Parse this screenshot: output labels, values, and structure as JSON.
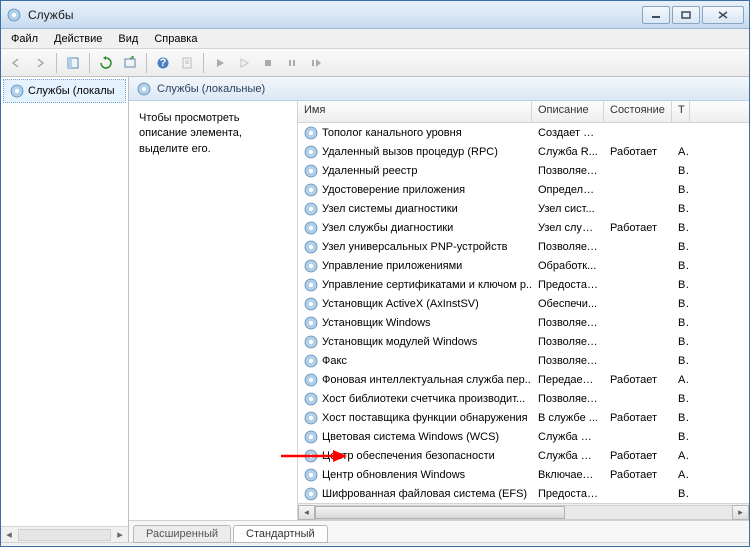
{
  "window": {
    "title": "Службы"
  },
  "menu": {
    "file": "Файл",
    "action": "Действие",
    "view": "Вид",
    "help": "Справка"
  },
  "tree": {
    "root": "Службы (локалы"
  },
  "pane": {
    "header": "Службы (локальные)"
  },
  "info": {
    "text": "Чтобы просмотреть описание элемента, выделите его."
  },
  "columns": {
    "name": "Имя",
    "desc": "Описание",
    "state": "Состояние",
    "type": "Т"
  },
  "tabs": {
    "extended": "Расширенный",
    "standard": "Стандартный"
  },
  "services": [
    {
      "name": "Тополог канального уровня",
      "desc": "Создает ка...",
      "state": "",
      "type": ""
    },
    {
      "name": "Удаленный вызов процедур (RPC)",
      "desc": "Служба R...",
      "state": "Работает",
      "type": "А"
    },
    {
      "name": "Удаленный реестр",
      "desc": "Позволяет...",
      "state": "",
      "type": "В"
    },
    {
      "name": "Удостоверение приложения",
      "desc": "Определя...",
      "state": "",
      "type": "В"
    },
    {
      "name": "Узел системы диагностики",
      "desc": "Узел сист...",
      "state": "",
      "type": "В"
    },
    {
      "name": "Узел службы диагностики",
      "desc": "Узел служ...",
      "state": "Работает",
      "type": "В"
    },
    {
      "name": "Узел универсальных PNP-устройств",
      "desc": "Позволяет...",
      "state": "",
      "type": "В"
    },
    {
      "name": "Управление приложениями",
      "desc": "Обработк...",
      "state": "",
      "type": "В"
    },
    {
      "name": "Управление сертификатами и ключом р...",
      "desc": "Предостав...",
      "state": "",
      "type": "В"
    },
    {
      "name": "Установщик ActiveX (AxInstSV)",
      "desc": "Обеспечи...",
      "state": "",
      "type": "В"
    },
    {
      "name": "Установщик Windows",
      "desc": "Позволяет...",
      "state": "",
      "type": "В"
    },
    {
      "name": "Установщик модулей Windows",
      "desc": "Позволяет...",
      "state": "",
      "type": "В"
    },
    {
      "name": "Факс",
      "desc": "Позволяет...",
      "state": "",
      "type": "В"
    },
    {
      "name": "Фоновая интеллектуальная служба пер...",
      "desc": "Передает ...",
      "state": "Работает",
      "type": "А"
    },
    {
      "name": "Хост библиотеки счетчика производит...",
      "desc": "Позволяет...",
      "state": "",
      "type": "В"
    },
    {
      "name": "Хост поставщика функции обнаружения",
      "desc": "В службе ...",
      "state": "Работает",
      "type": "В"
    },
    {
      "name": "Цветовая система Windows (WCS)",
      "desc": "Служба W...",
      "state": "",
      "type": "В"
    },
    {
      "name": "Центр обеспечения безопасности",
      "desc": "Служба W...",
      "state": "Работает",
      "type": "А"
    },
    {
      "name": "Центр обновления Windows",
      "desc": "Включает ...",
      "state": "Работает",
      "type": "А"
    },
    {
      "name": "Шифрованная файловая система (EFS)",
      "desc": "Предостав...",
      "state": "",
      "type": "В"
    }
  ]
}
